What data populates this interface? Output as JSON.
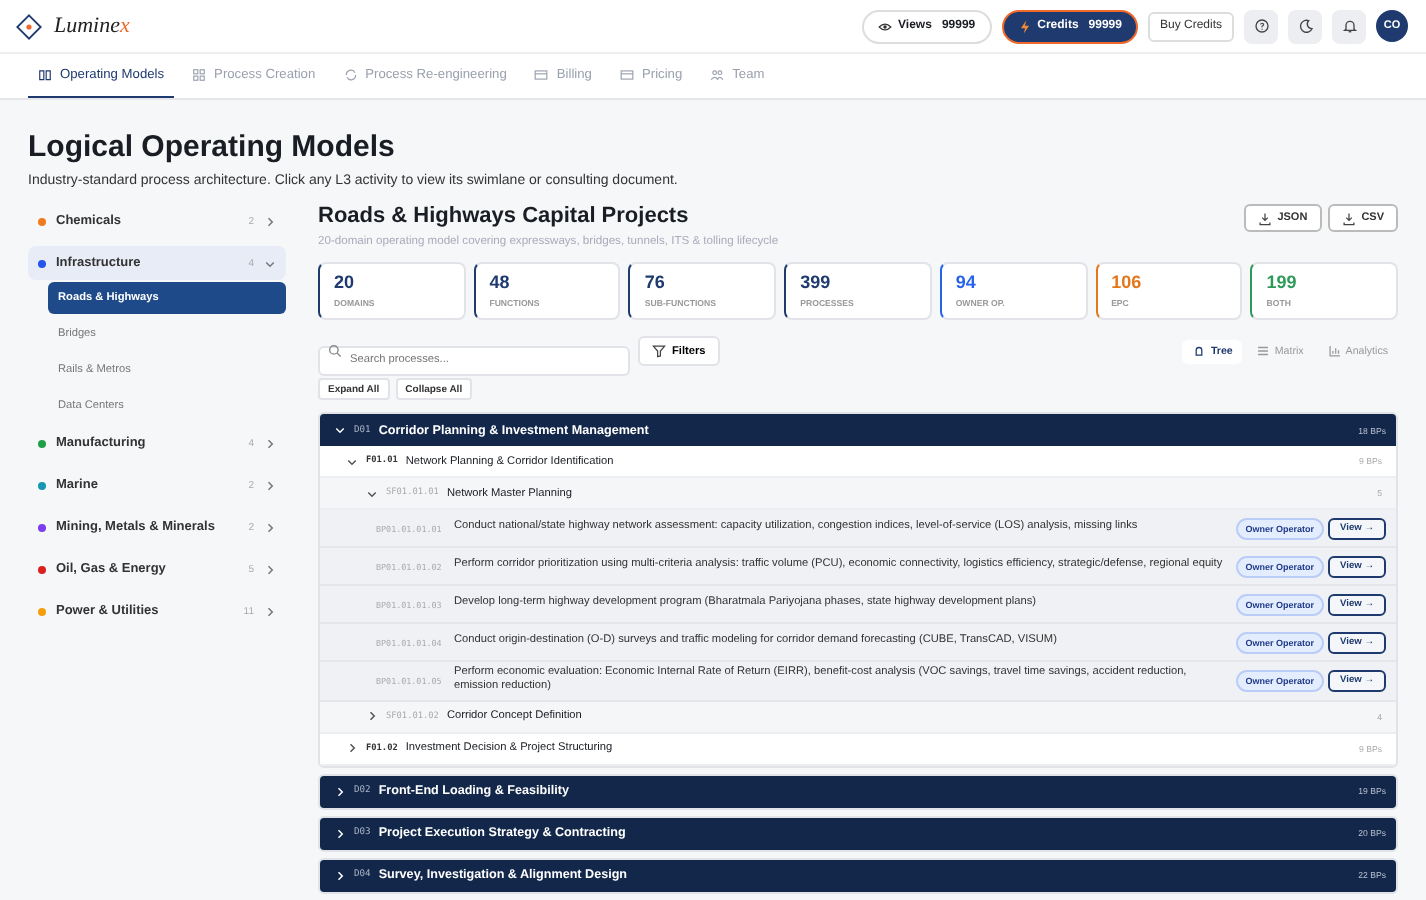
{
  "brand": {
    "name": "Lumine",
    "accent": "x"
  },
  "header": {
    "views_label": "Views",
    "views": "99999",
    "credits_label": "Credits",
    "credits": "99999",
    "buy": "Buy Credits",
    "avatar": "CO"
  },
  "tabs": [
    {
      "label": "Operating Models",
      "selected": true
    },
    {
      "label": "Process Creation",
      "selected": false
    },
    {
      "label": "Process Re-engineering",
      "selected": false
    },
    {
      "label": "Billing",
      "selected": false
    },
    {
      "label": "Pricing",
      "selected": false
    },
    {
      "label": "Team",
      "selected": false
    }
  ],
  "page": {
    "title": "Logical Operating Models",
    "subtitle": "Industry-standard process architecture. Click any L3 activity to view its swimlane or consulting document."
  },
  "sidebar": {
    "items": [
      {
        "name": "Chemicals",
        "count": "2",
        "color": "#f07c1b",
        "expanded": false
      },
      {
        "name": "Infrastructure",
        "count": "4",
        "color": "#2355e8",
        "expanded": true,
        "children": [
          {
            "name": "Roads & Highways",
            "selected": true
          },
          {
            "name": "Bridges",
            "selected": false
          },
          {
            "name": "Rails & Metros",
            "selected": false
          },
          {
            "name": "Data Centers",
            "selected": false
          }
        ]
      },
      {
        "name": "Manufacturing",
        "count": "4",
        "color": "#1fa046",
        "expanded": false
      },
      {
        "name": "Marine",
        "count": "2",
        "color": "#1597b4",
        "expanded": false
      },
      {
        "name": "Mining, Metals & Minerals",
        "count": "2",
        "color": "#7b3ef0",
        "expanded": false
      },
      {
        "name": "Oil, Gas & Energy",
        "count": "5",
        "color": "#dc2020",
        "expanded": false
      },
      {
        "name": "Power & Utilities",
        "count": "11",
        "color": "#f59e0b",
        "expanded": false
      }
    ]
  },
  "model": {
    "title": "Roads & Highways Capital Projects",
    "subtitle": "20-domain operating model covering expressways, bridges, tunnels, ITS & tolling lifecycle",
    "exports": [
      "JSON",
      "CSV"
    ]
  },
  "stats": [
    {
      "value": "20",
      "label": "DOMAINS",
      "color": "#1e3a6e"
    },
    {
      "value": "48",
      "label": "FUNCTIONS",
      "color": "#1e3a6e"
    },
    {
      "value": "76",
      "label": "SUB-FUNCTIONS",
      "color": "#1e3a6e"
    },
    {
      "value": "399",
      "label": "PROCESSES",
      "color": "#1e3a6e"
    },
    {
      "value": "94",
      "label": "OWNER OP.",
      "color": "#2563eb"
    },
    {
      "value": "106",
      "label": "EPC",
      "color": "#e4761b"
    },
    {
      "value": "199",
      "label": "BOTH",
      "color": "#2e9a5a"
    }
  ],
  "toolbar": {
    "search": {
      "placeholder": "Search processes..."
    },
    "filters": "Filters",
    "views": [
      {
        "label": "Tree",
        "selected": true
      },
      {
        "label": "Matrix",
        "selected": false
      },
      {
        "label": "Analytics",
        "selected": false
      }
    ],
    "expand_all": "Expand All",
    "collapse_all": "Collapse All"
  },
  "tree": [
    {
      "code": "D01",
      "name": "Corridor Planning & Investment Management",
      "count": "18 BPs",
      "expanded": true,
      "children": [
        {
          "code": "F01.01",
          "name": "Network Planning & Corridor Identification",
          "count": "9 BPs",
          "expanded": true,
          "children": [
            {
              "code": "SF01.01.01",
              "name": "Network Master Planning",
              "count": "5",
              "expanded": true,
              "children": [
                {
                  "code": "BP01.01.01.01",
                  "text": "Conduct national/state highway network assessment: capacity utilization, congestion indices, level-of-service (LOS) analysis, missing links",
                  "badge": "Owner Operator",
                  "action": "View →"
                },
                {
                  "code": "BP01.01.01.02",
                  "text": "Perform corridor prioritization using multi-criteria analysis: traffic volume (PCU), economic connectivity, logistics efficiency, strategic/defense, regional equity",
                  "badge": "Owner Operator",
                  "action": "View →"
                },
                {
                  "code": "BP01.01.01.03",
                  "text": "Develop long-term highway development program (Bharatmala Pariyojana phases, state highway development plans)",
                  "badge": "Owner Operator",
                  "action": "View →"
                },
                {
                  "code": "BP01.01.01.04",
                  "text": "Conduct origin-destination (O-D) surveys and traffic modeling for corridor demand forecasting (CUBE, TransCAD, VISUM)",
                  "badge": "Owner Operator",
                  "action": "View →"
                },
                {
                  "code": "BP01.01.01.05",
                  "text": "Perform economic evaluation: Economic Internal Rate of Return (EIRR), benefit-cost analysis (VOC savings, travel time savings, accident reduction, emission reduction)",
                  "badge": "Owner Operator",
                  "action": "View →"
                }
              ]
            },
            {
              "code": "SF01.01.02",
              "name": "Corridor Concept Definition",
              "count": "4",
              "expanded": false
            }
          ]
        },
        {
          "code": "F01.02",
          "name": "Investment Decision & Project Structuring",
          "count": "9 BPs",
          "expanded": false
        }
      ]
    },
    {
      "code": "D02",
      "name": "Front-End Loading & Feasibility",
      "count": "19 BPs",
      "expanded": false
    },
    {
      "code": "D03",
      "name": "Project Execution Strategy & Contracting",
      "count": "20 BPs",
      "expanded": false
    },
    {
      "code": "D04",
      "name": "Survey, Investigation & Alignment Design",
      "count": "22 BPs",
      "expanded": false
    }
  ]
}
